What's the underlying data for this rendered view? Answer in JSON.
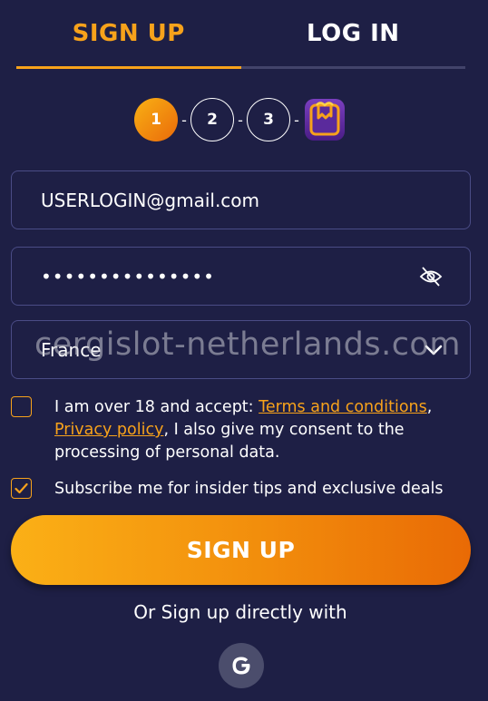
{
  "tabs": {
    "signup": "SIGN UP",
    "login": "LOG IN"
  },
  "steps": [
    "1",
    "2",
    "3"
  ],
  "step_separator": "-",
  "email": {
    "value": "USERLOGIN@gmail.com"
  },
  "password": {
    "masked": "•••••••••••••••"
  },
  "country": {
    "value": "France"
  },
  "watermark": "cergislot-netherlands.com",
  "terms": {
    "prefix": "I am over 18 and accept: ",
    "terms_link": "Terms and conditions",
    "comma": ",",
    "privacy_link": "Privacy policy",
    "suffix": ", I also give my consent to the processing of personal data."
  },
  "subscribe": {
    "label": "Subscribe me for insider tips and exclusive deals",
    "checked": true
  },
  "signup_button": "SIGN UP",
  "alt_signup": "Or Sign up directly with",
  "colors": {
    "background": "#1e1f45",
    "accent": "#f7a21b",
    "border": "#4a4c86"
  }
}
